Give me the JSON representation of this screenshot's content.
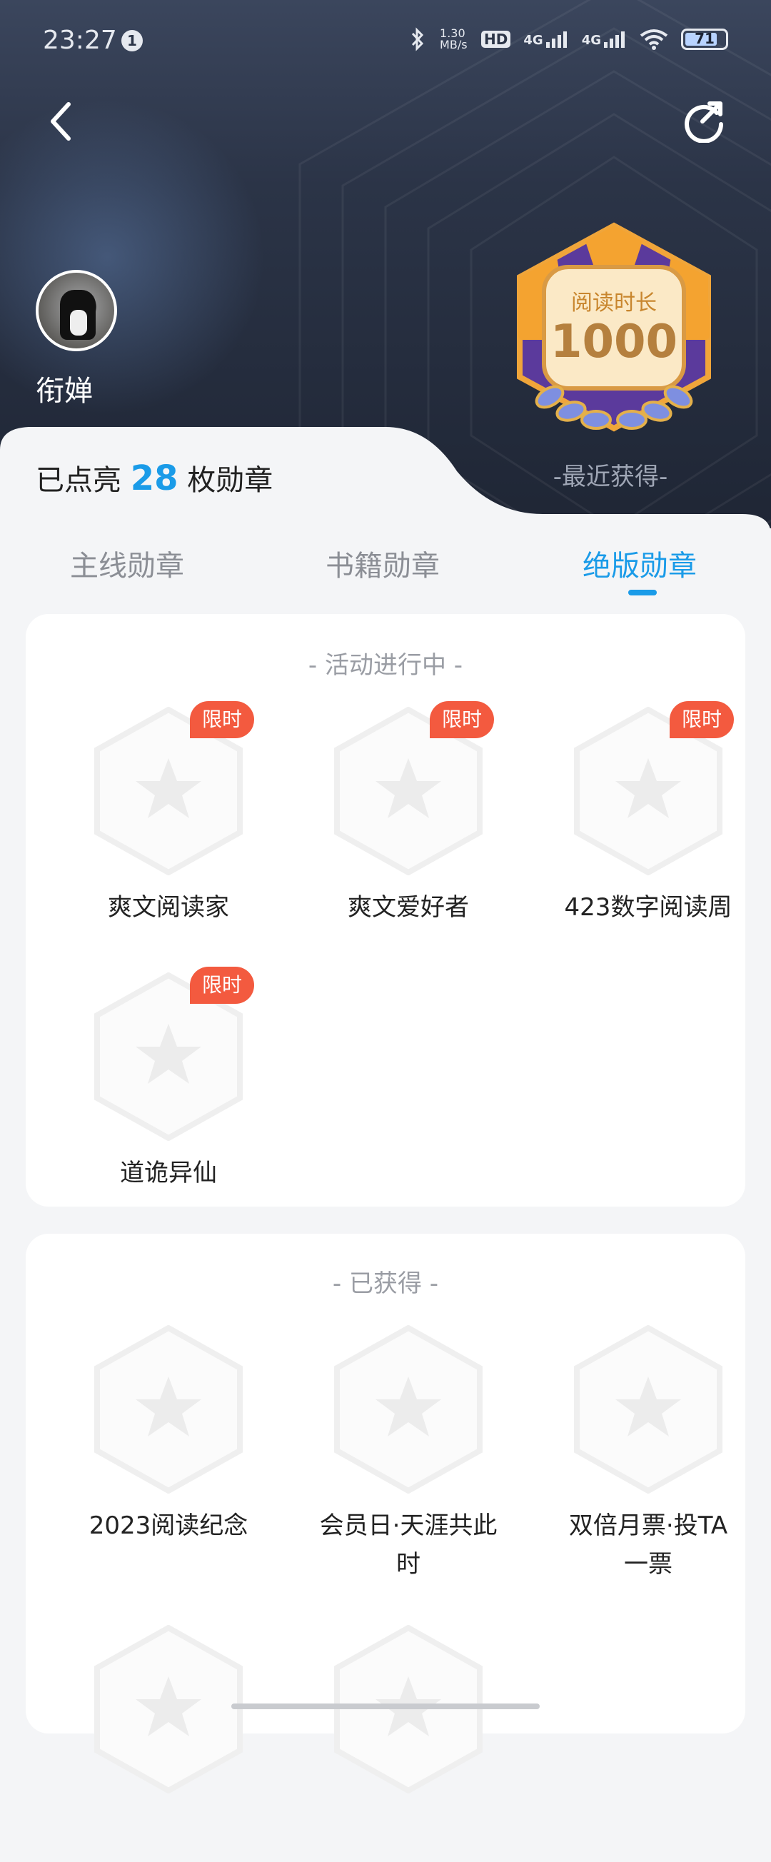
{
  "status_bar": {
    "time": "23:27",
    "notification_count": "1",
    "net_speed": "1.30\nMB/s",
    "hd": "HD",
    "sig1": "4G",
    "sig2": "4G",
    "battery": "71"
  },
  "header": {
    "username": "衔婵",
    "badge_top_text": "阅读时长",
    "badge_number": "1000",
    "recent_label": "-最近获得-"
  },
  "summary": {
    "prefix": "已点亮",
    "count": "28",
    "suffix": "枚勋章"
  },
  "tabs": [
    {
      "label": "主线勋章",
      "active": false
    },
    {
      "label": "书籍勋章",
      "active": false
    },
    {
      "label": "绝版勋章",
      "active": true
    }
  ],
  "sections": [
    {
      "title": "- 活动进行中 -",
      "items": [
        {
          "label": "爽文阅读家",
          "tag": "限时"
        },
        {
          "label": "爽文爱好者",
          "tag": "限时"
        },
        {
          "label": "423数字阅读周",
          "tag": "限时"
        },
        {
          "label": "道诡异仙",
          "tag": "限时"
        }
      ]
    },
    {
      "title": "- 已获得 -",
      "items": [
        {
          "label": "2023阅读纪念"
        },
        {
          "label_line1": "会员日·天涯共此",
          "label_line2": "时"
        },
        {
          "label_line1": "双倍月票·投TA",
          "label_line2": "一票"
        }
      ]
    }
  ],
  "colors": {
    "accent": "#1a9be8",
    "tag": "#f35a3f",
    "header_bg": "#2b3447"
  }
}
